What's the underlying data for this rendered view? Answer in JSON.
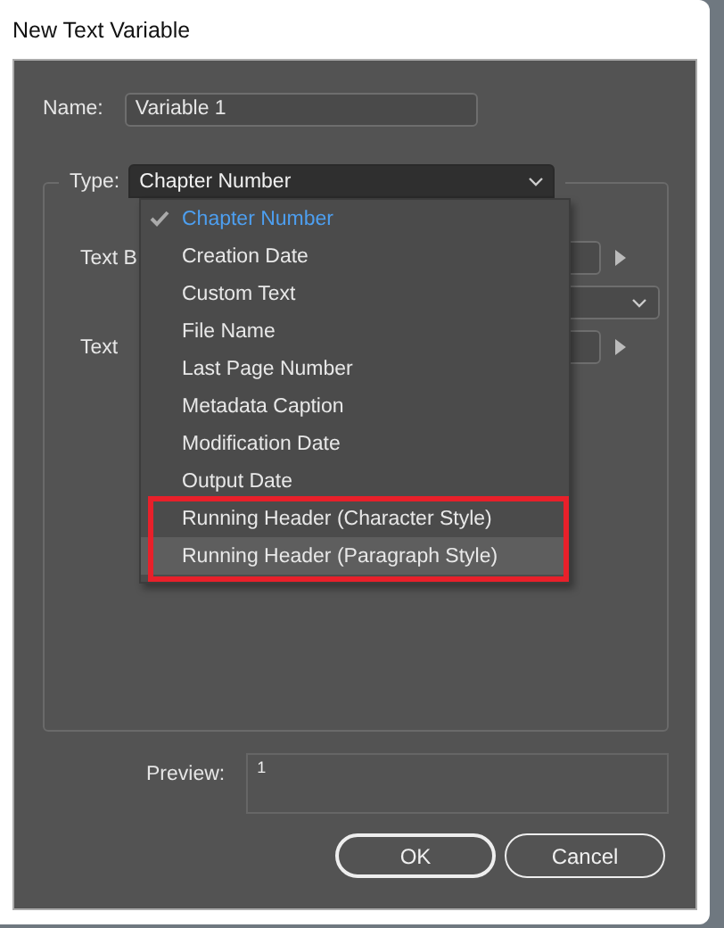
{
  "window": {
    "title": "New Text Variable"
  },
  "name": {
    "label": "Name:",
    "value": "Variable 1"
  },
  "type": {
    "label": "Type:",
    "value": "Chapter Number",
    "expanded": true
  },
  "type_menu": [
    {
      "label": "Chapter Number",
      "selected": true,
      "hovered": false
    },
    {
      "label": "Creation Date",
      "selected": false,
      "hovered": false
    },
    {
      "label": "Custom Text",
      "selected": false,
      "hovered": false
    },
    {
      "label": "File Name",
      "selected": false,
      "hovered": false
    },
    {
      "label": "Last Page Number",
      "selected": false,
      "hovered": false
    },
    {
      "label": "Metadata Caption",
      "selected": false,
      "hovered": false
    },
    {
      "label": "Modification Date",
      "selected": false,
      "hovered": false
    },
    {
      "label": "Output Date",
      "selected": false,
      "hovered": false
    },
    {
      "label": "Running Header (Character Style)",
      "selected": false,
      "hovered": false
    },
    {
      "label": "Running Header (Paragraph Style)",
      "selected": false,
      "hovered": true
    }
  ],
  "options": [
    {
      "kind": "field",
      "label": "Text B"
    },
    {
      "kind": "select"
    },
    {
      "kind": "field",
      "label": "Text"
    }
  ],
  "preview": {
    "label": "Preview:",
    "value": "1"
  },
  "buttons": [
    {
      "label": "OK",
      "default": true
    },
    {
      "label": "Cancel",
      "default": false
    }
  ]
}
